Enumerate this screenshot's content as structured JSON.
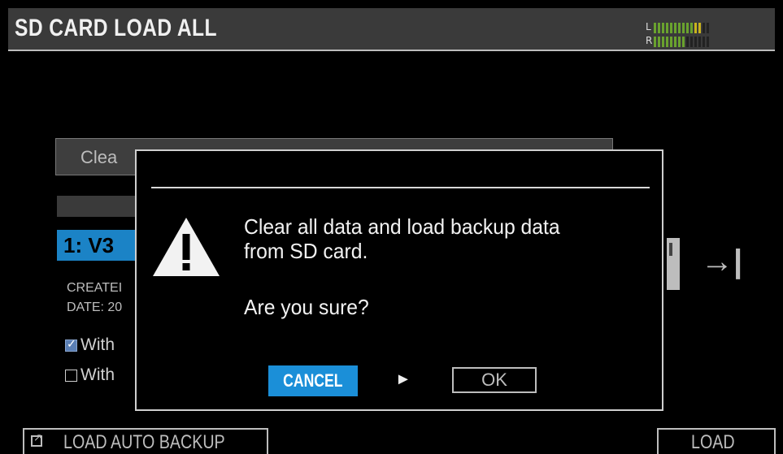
{
  "header": {
    "title": "SD CARD LOAD ALL"
  },
  "meter": {
    "left_label": "L",
    "right_label": "R",
    "left_level": 0.85,
    "right_level": 0.6
  },
  "background": {
    "field_text": "Clea",
    "selected_item": "1: V3",
    "info_lines": [
      "CREATEI",
      "DATE: 20"
    ],
    "checks": [
      {
        "label": "With",
        "checked": true
      },
      {
        "label": "With",
        "checked": false
      }
    ]
  },
  "dialog": {
    "message_line1": "Clear all data and load backup data",
    "message_line2": "from SD card.",
    "question": "Are you sure?",
    "cancel_label": "CANCEL",
    "pointer": "►",
    "ok_label": "OK"
  },
  "footer": {
    "left_label": "LOAD AUTO BACKUP",
    "right_label": "LOAD"
  },
  "colors": {
    "accent": "#1b8fd8",
    "selected": "#1b83c6",
    "background": "#000000",
    "titlebar": "#3a3a3a"
  },
  "icons": {
    "warning": "warning-triangle-icon",
    "external": "external-link-icon",
    "sd_card": "sd-card-icon",
    "import": "import-arrow-icon"
  }
}
